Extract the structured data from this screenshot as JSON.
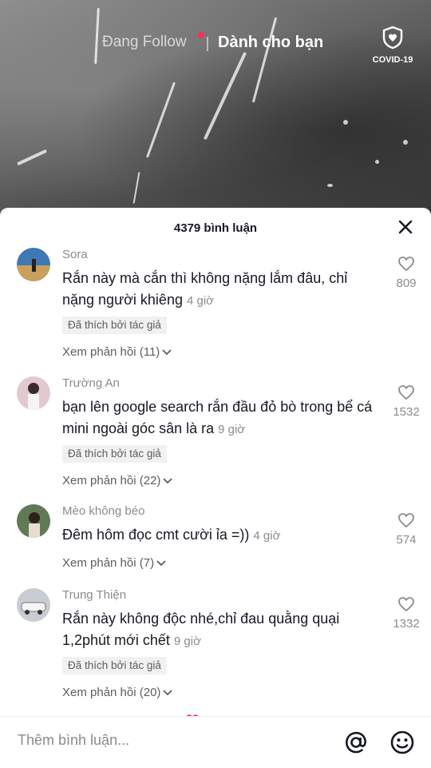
{
  "nav": {
    "following_label": "Đang Follow",
    "for_you_label": "Dành cho bạn",
    "covid_label": "COVID-19"
  },
  "comments_header": {
    "count_label": "4379 bình luận"
  },
  "comments": [
    {
      "username": "Sora",
      "text": "Rắn này mà cắn thì không nặng lắm đâu, chỉ nặng người khiêng",
      "time": "4 giờ",
      "badge": "Đã thích bởi tác giả",
      "replies": "Xem phản hồi (11)",
      "likes": "809",
      "avatar_color": "#3f78b5"
    },
    {
      "username": "Trường An",
      "text": "bạn lên google search rắn đầu đỏ bò trong bể cá mini ngoài góc sân là ra",
      "time": "9 giờ",
      "badge": "Đã thích bởi tác giả",
      "replies": "Xem phản hồi (22)",
      "likes": "1532",
      "avatar_color": "#b36d7a"
    },
    {
      "username": "Mèo không béo",
      "text": "Đêm hôm đọc cmt cười ỉa =))",
      "time": "4 giờ",
      "badge": "",
      "replies": "Xem phản hồi (7)",
      "likes": "574",
      "avatar_color": "#5f7a55"
    },
    {
      "username": "Trung Thiện",
      "text": "Rắn này không độc nhé,chỉ đau quằng quại 1,2phút mới chết",
      "time": "9 giờ",
      "badge": "Đã thích bởi tác giả",
      "replies": "Xem phản hồi (20)",
      "likes": "1332",
      "avatar_color": "#9aa2a8"
    }
  ],
  "footer": {
    "placeholder": "Thêm bình luận..."
  },
  "colors": {
    "accent": "#fe2c55",
    "text": "#161823",
    "muted": "#8a8b91"
  },
  "icons": [
    "covid-shield-icon",
    "close-icon",
    "heart-icon",
    "chevron-down-icon",
    "at-sign-icon",
    "emoji-icon"
  ]
}
